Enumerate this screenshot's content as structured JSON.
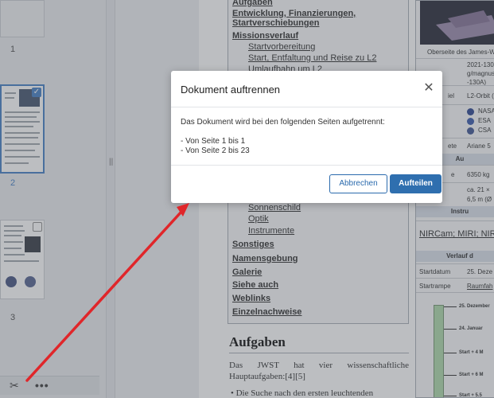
{
  "thumbnails": [
    {
      "number": "1"
    },
    {
      "number": "2",
      "selected": true
    },
    {
      "number": "3",
      "selected": false
    }
  ],
  "toolbar": {
    "split_icon": "scissors-icon",
    "more_icon": "more-icon",
    "more_label": "•••"
  },
  "toc": [
    {
      "label": "Aufgaben",
      "level": 1
    },
    {
      "label": "Entwicklung, Finanzierungen, Startverschiebungen",
      "level": 1
    },
    {
      "label": "Missionsverlauf",
      "level": 1
    },
    {
      "label": "Startvorbereitung",
      "level": 2
    },
    {
      "label": "Start, Entfaltung und Reise zu L2",
      "level": 2
    },
    {
      "label": "Umlaufbahn um L2",
      "level": 2
    },
    {
      "label": "Sonnenschild",
      "level": 2
    },
    {
      "label": "Optik",
      "level": 2
    },
    {
      "label": "Instrumente",
      "level": 2
    },
    {
      "label": "Sonstiges",
      "level": 1
    },
    {
      "label": "Namensgebung",
      "level": 1
    },
    {
      "label": "Galerie",
      "level": 1
    },
    {
      "label": "Siehe auch",
      "level": 1
    },
    {
      "label": "Weblinks",
      "level": 1
    },
    {
      "label": "Einzelnachweise",
      "level": 1
    }
  ],
  "article": {
    "heading": "Aufgaben",
    "paragraph": "Das JWST hat vier wissenschaftliche Hauptaufgaben:[4][5]",
    "bullet": "Die Suche nach den ersten leuchtenden"
  },
  "infobox": {
    "caption": "Oberseite des James-W",
    "mass_text": "2021-130",
    "mass_text2": "g/magnus",
    "mass_text3": "-130A)",
    "label_i": "iel",
    "orbit": "L2-Orbit (",
    "agencies": [
      "NASA",
      "ESA",
      "CSA"
    ],
    "label_ete": "ete",
    "rocket": "Ariane 5",
    "section_au": "Au",
    "label_e": "e",
    "weight": "6350 kg",
    "size1": "ca. 21 ×",
    "size2": "6,5 m (Ø",
    "section_instr": "Instru",
    "instruments": "NIRCam; MIRI; NIRS",
    "section_verlauf": "Verlauf d",
    "startdatum_label": "Startdatum",
    "startdatum_value": "25. Deze",
    "startrampe_label": "Startrampe",
    "startrampe_value": "Raumfah",
    "timeline": [
      "25. Dezember",
      "24. Januar",
      "Start + 4 M",
      "Start + 6 M",
      "Start + 5.5"
    ]
  },
  "dialog": {
    "title": "Dokument auftrennen",
    "close_icon": "close-icon",
    "body_intro": "Das Dokument wird bei den folgenden Seiten aufgetrennt:",
    "parts": [
      "- Von Seite 1 bis 1",
      "- Von Seite 2 bis 23"
    ],
    "cancel_label": "Abbrechen",
    "confirm_label": "Aufteilen"
  },
  "colors": {
    "accent": "#2f6faf",
    "arrow": "#e0262a"
  }
}
